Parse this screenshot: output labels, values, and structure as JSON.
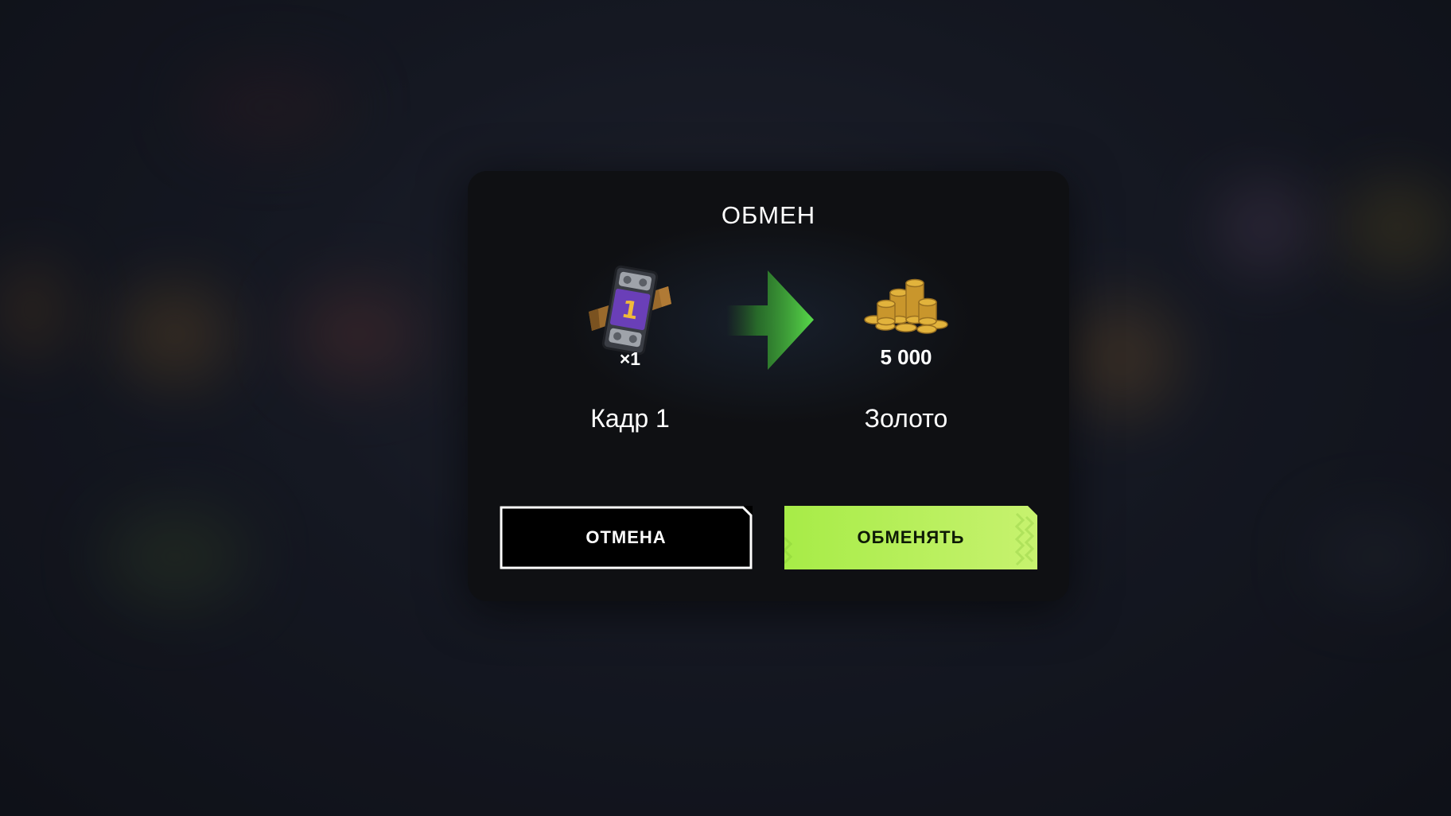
{
  "dialog": {
    "title": "ОБМЕН",
    "from_item": {
      "name": "Кадр 1",
      "count": "×1",
      "icon": "film-frame-icon",
      "badge_number": "1"
    },
    "to_item": {
      "name": "Золото",
      "amount": "5 000",
      "icon": "gold-coins-icon"
    },
    "arrow_icon": "arrow-right-icon",
    "buttons": {
      "cancel_label": "ОТМЕНА",
      "confirm_label": "ОБМЕНЯТЬ"
    }
  },
  "colors": {
    "modal_bg": "#0f1013",
    "confirm_button": "#b4ef58",
    "arrow_green": "#47c53b",
    "badge_purple": "#6a3fb8",
    "badge_number": "#f0b93a",
    "gold": "#e2b33c"
  }
}
